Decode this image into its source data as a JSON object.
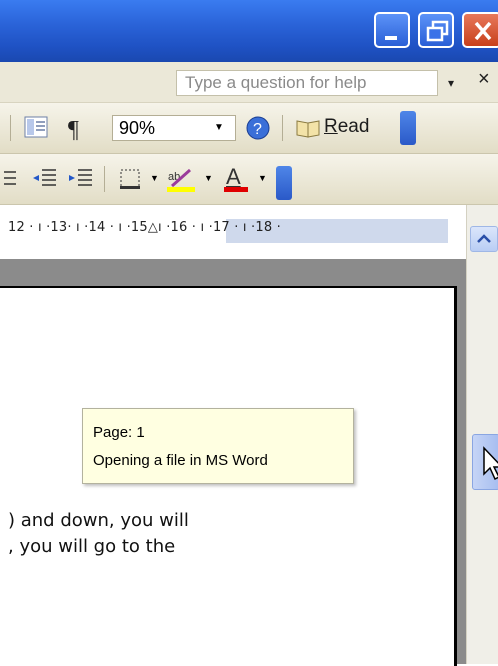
{
  "help": {
    "placeholder": "Type a question for help",
    "dropdown_glyph": "▾",
    "close_glyph": "×"
  },
  "toolbar": {
    "pilcrow": "¶",
    "zoom": "90%",
    "read_prefix": "",
    "read_key": "R",
    "read_rest": "ead"
  },
  "ruler": {
    "text": "12 · ı ·13· ı ·14 · ı ·15△ı ·16 · ı ·17 · ı ·18 ·"
  },
  "tooltip": {
    "page": "Page: 1",
    "title": "Opening a file in MS Word"
  },
  "document": {
    "line1": ") and down, you will",
    "line2": ", you will go to the"
  },
  "colors": {
    "titlebar": "#2a63d8",
    "tooltip_bg": "#ffffe1",
    "highlight": "#ffff00",
    "font_color": "#e00000"
  }
}
